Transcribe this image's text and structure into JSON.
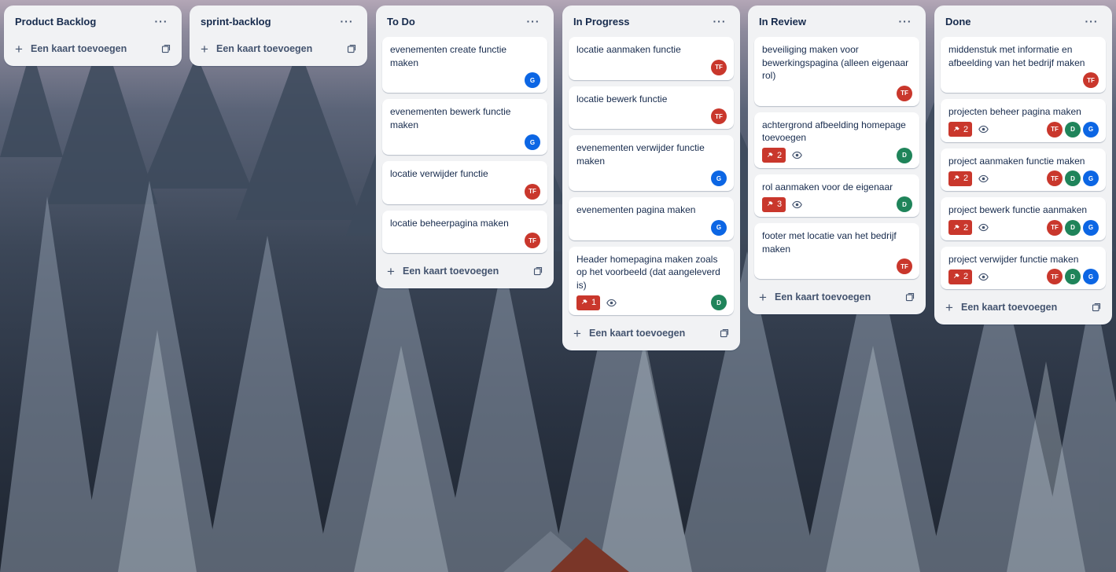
{
  "board": {
    "add_card_label": "Een kaart toevoegen",
    "menu_glyph": "···",
    "lists": [
      {
        "title": "Product Backlog",
        "cards": []
      },
      {
        "title": "sprint-backlog",
        "cards": []
      },
      {
        "title": "To Do",
        "cards": [
          {
            "title": "evenementen create functie maken",
            "due": null,
            "watch": false,
            "members": [
              "G"
            ]
          },
          {
            "title": "evenementen bewerk functie maken",
            "due": null,
            "watch": false,
            "members": [
              "G"
            ]
          },
          {
            "title": "locatie verwijder functie",
            "due": null,
            "watch": false,
            "members": [
              "TF"
            ]
          },
          {
            "title": "locatie beheerpagina maken",
            "due": null,
            "watch": false,
            "members": [
              "TF"
            ]
          }
        ]
      },
      {
        "title": "In Progress",
        "cards": [
          {
            "title": "locatie aanmaken functie",
            "due": null,
            "watch": false,
            "members": [
              "TF"
            ]
          },
          {
            "title": "locatie bewerk functie",
            "due": null,
            "watch": false,
            "members": [
              "TF"
            ]
          },
          {
            "title": "evenementen verwijder functie maken",
            "due": null,
            "watch": false,
            "members": [
              "G"
            ]
          },
          {
            "title": "evenementen pagina maken",
            "due": null,
            "watch": false,
            "members": [
              "G"
            ]
          },
          {
            "title": "Header homepagina maken zoals op het voorbeeld (dat aangeleverd is)",
            "due": "1",
            "watch": true,
            "members": [
              "D"
            ]
          }
        ]
      },
      {
        "title": "In Review",
        "cards": [
          {
            "title": "beveiliging maken voor bewerkingspagina (alleen eigenaar rol)",
            "due": null,
            "watch": false,
            "members": [
              "TF"
            ]
          },
          {
            "title": "achtergrond afbeelding homepage toevoegen",
            "due": "2",
            "watch": true,
            "members": [
              "D"
            ]
          },
          {
            "title": "rol aanmaken voor de eigenaar",
            "due": "3",
            "watch": true,
            "members": [
              "D"
            ]
          },
          {
            "title": "footer met locatie van het bedrijf maken",
            "due": null,
            "watch": false,
            "members": [
              "TF"
            ]
          }
        ]
      },
      {
        "title": "Done",
        "cards": [
          {
            "title": "middenstuk met informatie en afbeelding van het bedrijf maken",
            "due": null,
            "watch": false,
            "members": [
              "TF"
            ]
          },
          {
            "title": "projecten beheer pagina maken",
            "due": "2",
            "watch": true,
            "members": [
              "TF",
              "D",
              "G"
            ]
          },
          {
            "title": "project aanmaken functie maken",
            "due": "2",
            "watch": true,
            "members": [
              "TF",
              "D",
              "G"
            ]
          },
          {
            "title": "project bewerk functie aanmaken",
            "due": "2",
            "watch": true,
            "members": [
              "TF",
              "D",
              "G"
            ]
          },
          {
            "title": "project verwijder functie maken",
            "due": "2",
            "watch": true,
            "members": [
              "TF",
              "D",
              "G"
            ]
          }
        ]
      }
    ]
  },
  "member_colors": {
    "TF": "#c9372c",
    "D": "#1f845a",
    "G": "#0c66e4"
  },
  "colors": {
    "due_badge": "#c9372c",
    "list_bg": "#f1f2f4",
    "card_bg": "#ffffff",
    "text": "#172b4d"
  }
}
